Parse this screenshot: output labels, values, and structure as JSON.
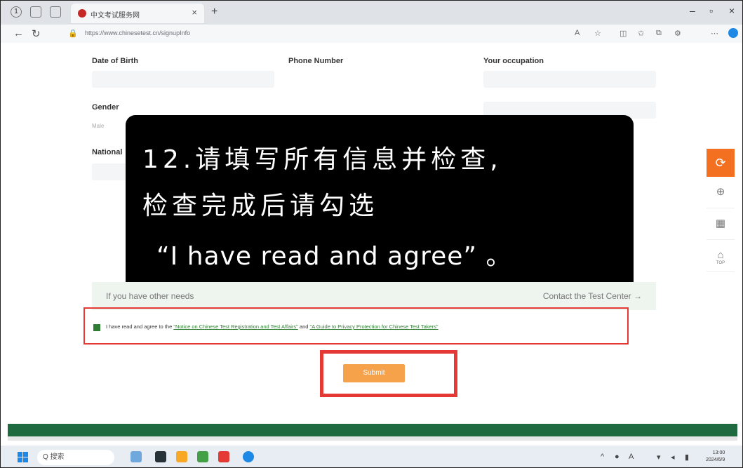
{
  "browser": {
    "tab_title": "中文考试服务网",
    "url": "https://www.chinesetest.cn/signupInfo",
    "new_tab_symbol": "+",
    "close_tab_symbol": "×",
    "win_min": "–",
    "win_max": "▫",
    "win_close": "×"
  },
  "form": {
    "date_of_birth_label": "Date of Birth",
    "phone_label": "Phone Number",
    "occupation_label": "Your occupation",
    "gender_label": "Gender",
    "gender_option": "Male",
    "nationality_label": "National"
  },
  "overlay": {
    "line1": "12.请填写所有信息并检查,",
    "line2": "检查完成后请勾选",
    "line3": "“I have read and agree” 。"
  },
  "needs": {
    "left": "If you have other needs",
    "right": "Contact the Test Center →"
  },
  "agreement": {
    "prefix": "I have read and agree to the ",
    "link1": "\"Notice on Chinese Test Registration and Test Affairs\"",
    "middle": " and ",
    "link2": "\"A Guide to Privacy Protection for Chinese Test Takers\""
  },
  "submit_label": "Submit",
  "float_menu": {
    "top_icon": "⟳",
    "item1": "⊕",
    "item2": "▦",
    "item3": "⌂",
    "item3_sub": "TOP"
  },
  "taskbar": {
    "search_text": "Q 搜索",
    "time": "13:00",
    "date": "2024/6/9"
  },
  "colors": {
    "accent": "#f37021",
    "submit": "#f6a24a",
    "highlight": "#e53935",
    "green": "#2e7d32"
  }
}
